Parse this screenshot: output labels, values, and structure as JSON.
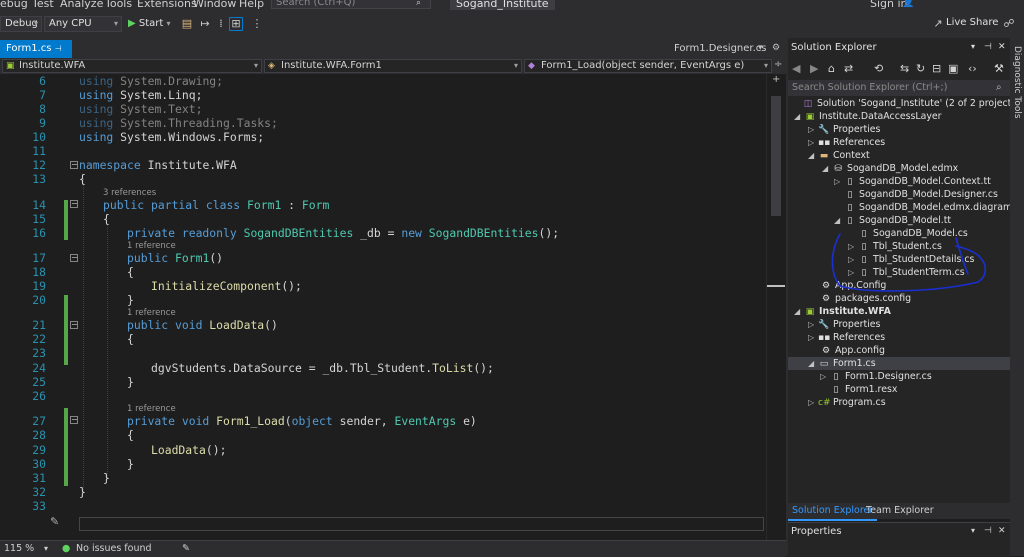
{
  "menu": {
    "items": [
      "ebug",
      "Test",
      "Analyze",
      "Tools",
      "Extensions",
      "Window",
      "Help"
    ],
    "search_placeholder": "Search (Ctrl+Q)",
    "solution_name": "Sogand_Institute",
    "sign_in": "Sign in",
    "live_share": "Live Share"
  },
  "toolbar": {
    "configuration": "Debug",
    "platform": "Any CPU",
    "start_label": "Start"
  },
  "tabs": {
    "active": "Form1.cs",
    "other": "Form1.Designer.cs"
  },
  "navbar": {
    "project": "Institute.WFA",
    "class": "Institute.WFA.Form1",
    "member": "Form1_Load(object sender, EventArgs e)"
  },
  "editor": {
    "line_numbers": [
      "6",
      "7",
      "8",
      "9",
      "10",
      "11",
      "12",
      "13",
      "14",
      "15",
      "16",
      "17",
      "18",
      "19",
      "20",
      "21",
      "22",
      "23",
      "24",
      "25",
      "26",
      "27",
      "28",
      "29",
      "30",
      "31",
      "32",
      "33"
    ],
    "lines": {
      "l6_kw": "using",
      "l6_ns": " System.Drawing;",
      "l7_kw": "using",
      "l7_ns": " System.Linq;",
      "l8_kw": "using",
      "l8_ns": " System.Text;",
      "l9_kw": "using",
      "l9_ns": " System.Threading.Tasks;",
      "l10_kw": "using",
      "l10_ns": " System.Windows.Forms;",
      "l12_kw": "namespace",
      "l12_ns": " Institute.WFA",
      "brace_open": "{",
      "brace_close": "}",
      "l14_mods": "public partial class ",
      "l14_cls": "Form1",
      "l14_sep": " : ",
      "l14_base": "Form",
      "l16_mods": "private readonly ",
      "l16_type": "SogandDBEntities",
      "l16_field": " _db = ",
      "l16_new": "new ",
      "l16_ctor": "SogandDBEntities",
      "l16_end": "();",
      "l17_kw": "public ",
      "l17_name": "Form1",
      "l17_end": "()",
      "l19_call": "InitializeComponent",
      "l19_end": "();",
      "l21_kw": "public void ",
      "l21_name": "LoadData",
      "l21_end": "()",
      "l24_obj": "dgvStudents",
      "l24_mid": ".DataSource = _db.Tbl_Student.",
      "l24_call": "ToList",
      "l24_end": "();",
      "l27_kw": "private void ",
      "l27_name": "Form1_Load",
      "l27_p1": "(",
      "l27_okw": "object",
      "l27_sender": " sender, ",
      "l27_eargs": "EventArgs",
      "l27_end": " e)",
      "l29_call": "LoadData",
      "l29_end": "();"
    },
    "lens": {
      "class_refs": "3 references",
      "ref1": "1 reference",
      "ref2": "1 reference",
      "ref3": "1 reference"
    }
  },
  "status": {
    "zoom": "115 %",
    "issues": "No issues found"
  },
  "solution_explorer": {
    "title": "Solution Explorer",
    "search_placeholder": "Search Solution Explorer (Ctrl+;)",
    "items": [
      "Solution 'Sogand_Institute' (2 of 2 projects)",
      "Institute.DataAccessLayer",
      "Properties",
      "References",
      "Context",
      "SogandDB_Model.edmx",
      "SogandDB_Model.Context.tt",
      "SogandDB_Model.Designer.cs",
      "SogandDB_Model.edmx.diagram",
      "SogandDB_Model.tt",
      "SogandDB_Model.cs",
      "Tbl_Student.cs",
      "Tbl_StudentDetails.cs",
      "Tbl_StudentTerm.cs",
      "App.Config",
      "packages.config",
      "Institute.WFA",
      "Properties",
      "References",
      "App.config",
      "Form1.cs",
      "Form1.Designer.cs",
      "Form1.resx",
      "Program.cs"
    ],
    "tab_active": "Solution Explorer",
    "tab_other": "Team Explorer",
    "properties_title": "Properties",
    "diagnostic_tools": "Diagnostic Tools"
  },
  "colors": {
    "accent": "#007acc",
    "keyword": "#569cd6",
    "type": "#4ec9b0",
    "method": "#dcdcaa",
    "annotation": "#1a2fd0"
  }
}
